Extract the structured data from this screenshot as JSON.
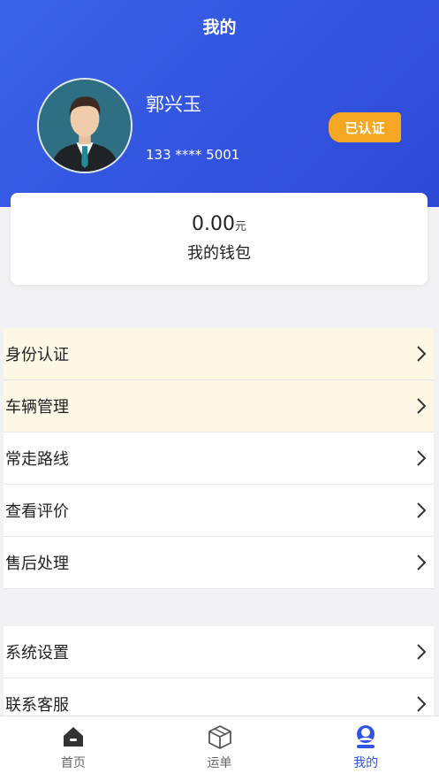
{
  "header": {
    "title": "我的"
  },
  "profile": {
    "name": "郭兴玉",
    "phone": "133 **** 5001",
    "badge": "已认证"
  },
  "wallet": {
    "amount": "0.00",
    "unit": "元",
    "label": "我的钱包"
  },
  "menu_group_1": [
    {
      "label": "身份认证",
      "icon": "chevron-right-icon"
    },
    {
      "label": "车辆管理",
      "icon": "chevron-right-icon"
    },
    {
      "label": "常走路线",
      "icon": "chevron-right-icon"
    },
    {
      "label": "查看评价",
      "icon": "chevron-right-icon"
    },
    {
      "label": "售后处理",
      "icon": "chevron-right-icon"
    }
  ],
  "menu_group_2": [
    {
      "label": "系统设置",
      "icon": "chevron-right-icon"
    },
    {
      "label": "联系客服",
      "icon": "chevron-right-icon"
    }
  ],
  "tabbar": {
    "home": {
      "label": "首页",
      "icon": "home-icon"
    },
    "orders": {
      "label": "运单",
      "icon": "box-icon"
    },
    "mine": {
      "label": "我的",
      "icon": "user-icon"
    }
  },
  "colors": {
    "header_blue": "#3354df",
    "badge_orange": "#f5a623",
    "highlight_row": "#fdf7e6",
    "active_tab": "#2f55e0"
  }
}
